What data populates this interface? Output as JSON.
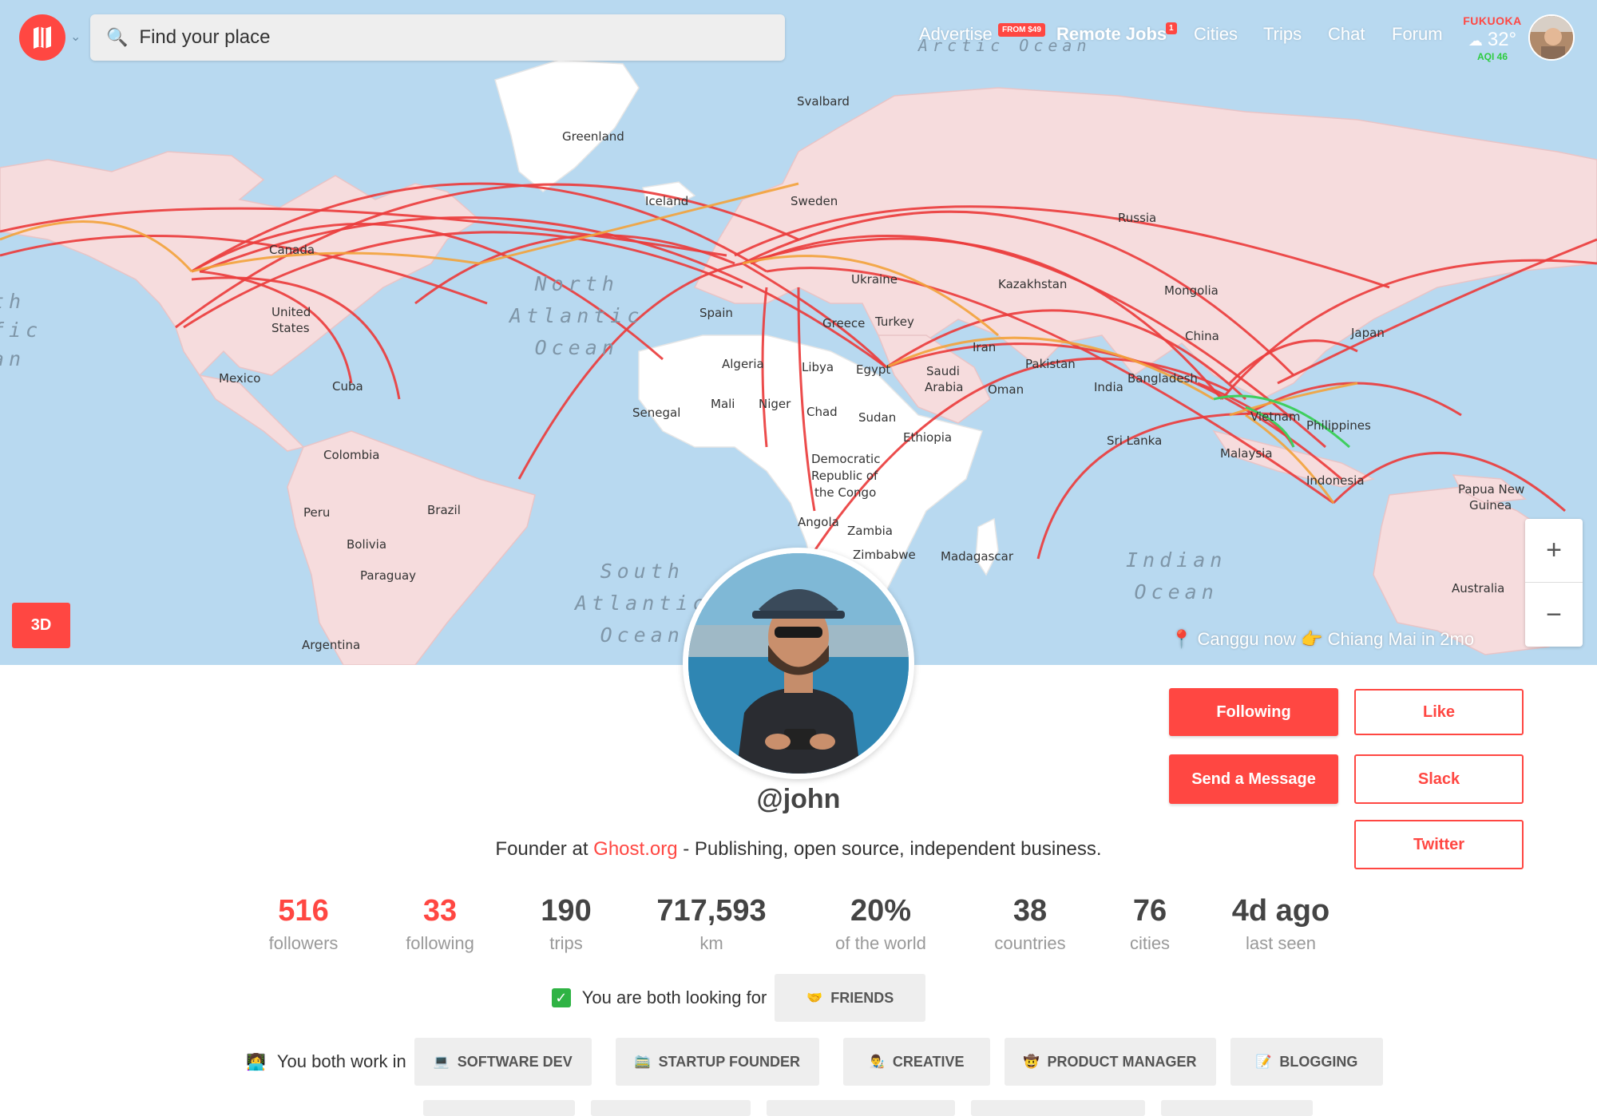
{
  "header": {
    "search_placeholder": "Find your place",
    "nav": {
      "advertise": "Advertise",
      "advertise_badge": "FROM $49",
      "remote_jobs": "Remote Jobs",
      "remote_jobs_badge": "1",
      "cities": "Cities",
      "trips": "Trips",
      "chat": "Chat",
      "forum": "Forum"
    },
    "weather": {
      "city": "FUKUOKA",
      "icon": "☁",
      "temp": "32°",
      "aqi": "AQI 46"
    }
  },
  "map": {
    "btn_3d": "3D",
    "zoom_in": "+",
    "zoom_out": "−",
    "location_note": "📍 Canggu now 👉 Chiang Mai in 2mo",
    "countries": {
      "greenland": "Greenland",
      "svalbard": "Svalbard",
      "iceland": "Iceland",
      "sweden": "Sweden",
      "russia": "Russia",
      "canada": "Canada",
      "united_states_1": "United",
      "united_states_2": "States",
      "mexico": "Mexico",
      "cuba": "Cuba",
      "colombia": "Colombia",
      "peru": "Peru",
      "brazil": "Brazil",
      "bolivia": "Bolivia",
      "paraguay": "Paraguay",
      "argentina": "Argentina",
      "spain": "Spain",
      "ukraine": "Ukraine",
      "greece": "Greece",
      "turkey": "Turkey",
      "algeria": "Algeria",
      "libya": "Libya",
      "egypt": "Egypt",
      "mali": "Mali",
      "niger": "Niger",
      "chad": "Chad",
      "sudan": "Sudan",
      "senegal": "Senegal",
      "ethiopia": "Ethiopia",
      "drc_1": "Democratic",
      "drc_2": "Republic of",
      "drc_3": "the Congo",
      "angola": "Angola",
      "zambia": "Zambia",
      "zimbabwe": "Zimbabwe",
      "madagascar": "Madagascar",
      "saudi_1": "Saudi",
      "saudi_2": "Arabia",
      "iran": "Iran",
      "oman": "Oman",
      "pakistan": "Pakistan",
      "kazakhstan": "Kazakhstan",
      "mongolia": "Mongolia",
      "china": "China",
      "japan": "Japan",
      "india": "India",
      "bangladesh": "Bangladesh",
      "sri_lanka": "Sri Lanka",
      "vietnam": "Vietnam",
      "philippines": "Philippines",
      "malaysia": "Malaysia",
      "indonesia": "Indonesia",
      "papua_1": "Papua New",
      "papua_2": "Guinea",
      "australia": "Australia"
    },
    "oceans": {
      "arctic": "Arctic Ocean",
      "north_atlantic": "North\nAtlantic\nOcean",
      "south_atlantic": "South\nAtlantic\nOcean",
      "indian": "Indian\nOcean",
      "pacific_left": "th\nfic\nan"
    }
  },
  "profile": {
    "username": "@john",
    "bio_prefix": "Founder at ",
    "bio_link": "Ghost.org",
    "bio_suffix": " - Publishing, open source, independent business.",
    "buttons": {
      "following": "Following",
      "like": "Like",
      "send_message": "Send a Message",
      "slack": "Slack",
      "twitter": "Twitter"
    },
    "stats": [
      {
        "value": "516",
        "label": "followers"
      },
      {
        "value": "33",
        "label": "following"
      },
      {
        "value": "190",
        "label": "trips"
      },
      {
        "value": "717,593",
        "label": "km"
      },
      {
        "value": "20%",
        "label": "of the world"
      },
      {
        "value": "38",
        "label": "countries"
      },
      {
        "value": "76",
        "label": "cities"
      },
      {
        "value": "4d ago",
        "label": "last seen"
      }
    ],
    "looking_for": {
      "text": "You are both looking for",
      "tag_emoji": "🤝",
      "tag": "FRIENDS"
    },
    "work_in": {
      "emoji": "👩‍💻",
      "text": "You both work in",
      "tags": [
        {
          "emoji": "💻",
          "label": "SOFTWARE DEV"
        },
        {
          "emoji": "🚞",
          "label": "STARTUP FOUNDER"
        },
        {
          "emoji": "👨‍🎨",
          "label": "CREATIVE"
        },
        {
          "emoji": "🤠",
          "label": "PRODUCT MANAGER"
        },
        {
          "emoji": "📝",
          "label": "BLOGGING"
        }
      ]
    }
  }
}
